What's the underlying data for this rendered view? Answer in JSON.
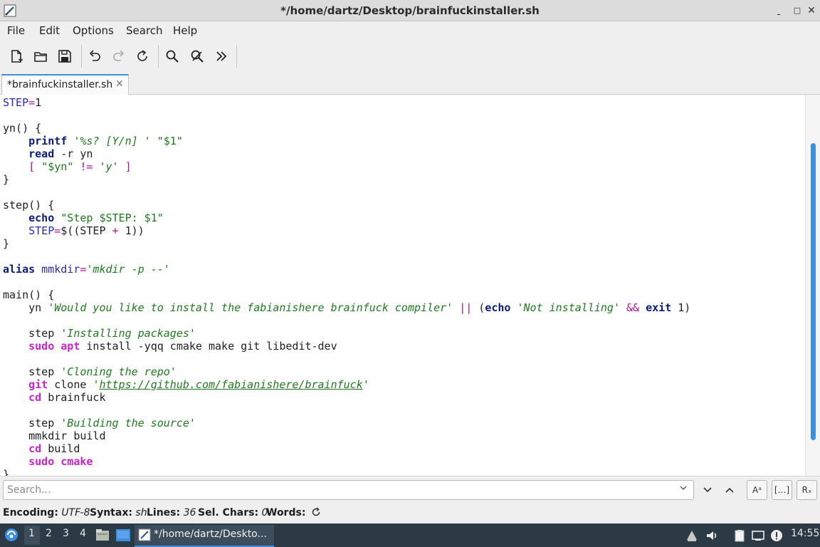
{
  "window": {
    "title": "*/home/dartz/Desktop/brainfuckinstaller.sh",
    "minimize": "ˍ",
    "restore": "□",
    "close": "✕"
  },
  "menu": [
    "File",
    "Edit",
    "Options",
    "Search",
    "Help"
  ],
  "toolbar": {
    "icons": [
      "new-file-icon",
      "open-folder-icon",
      "save-icon",
      "undo-icon",
      "redo-icon",
      "reload-icon",
      "find-icon",
      "find-replace-icon",
      "more-icon"
    ]
  },
  "tab": {
    "label": "*brainfuckinstaller.sh",
    "close": "✕"
  },
  "code_lines": [
    [
      [
        "v",
        "STEP"
      ],
      [
        "o",
        "="
      ],
      [
        "",
        "1"
      ]
    ],
    [],
    [
      [
        "",
        "yn() {"
      ]
    ],
    [
      [
        "",
        "    "
      ],
      [
        "k",
        "printf"
      ],
      [
        "",
        ""
      ],
      [
        "si",
        " '%s? [Y/n] '"
      ],
      [
        "s",
        " \"$1\""
      ]
    ],
    [
      [
        "",
        "    "
      ],
      [
        "k",
        "read"
      ],
      [
        "",
        " -r yn"
      ]
    ],
    [
      [
        "",
        "    "
      ],
      [
        "o",
        "["
      ],
      [
        "s",
        " \"$yn\""
      ],
      [
        "o",
        " !="
      ],
      [
        "si",
        " 'y'"
      ],
      [
        "o",
        " ]"
      ]
    ],
    [
      [
        "",
        "}"
      ]
    ],
    [],
    [
      [
        "",
        "step() {"
      ]
    ],
    [
      [
        "",
        "    "
      ],
      [
        "k",
        "echo"
      ],
      [
        "s",
        " \"Step $STEP: $1\""
      ]
    ],
    [
      [
        "",
        "    "
      ],
      [
        "v",
        "STEP"
      ],
      [
        "o",
        "="
      ],
      [
        "",
        "$((STEP "
      ],
      [
        "o",
        "+"
      ],
      [
        "",
        " 1))"
      ]
    ],
    [
      [
        "",
        "}"
      ]
    ],
    [],
    [
      [
        "k",
        "alias"
      ],
      [
        "v",
        " mmkdir"
      ],
      [
        "o",
        "="
      ],
      [
        "si",
        "'mkdir -p --'"
      ]
    ],
    [],
    [
      [
        "",
        "main() {"
      ]
    ],
    [
      [
        "",
        "    yn "
      ],
      [
        "si",
        "'Would you like to install the fabianishere brainfuck compiler'"
      ],
      [
        "o",
        " ||"
      ],
      [
        "",
        " ("
      ],
      [
        "k",
        "echo"
      ],
      [
        "si",
        " 'Not installing'"
      ],
      [
        "o",
        " &&"
      ],
      [
        "k",
        " exit"
      ],
      [
        "",
        " 1)"
      ]
    ],
    [],
    [
      [
        "",
        "    step "
      ],
      [
        "si",
        "'Installing packages'"
      ]
    ],
    [
      [
        "",
        "    "
      ],
      [
        "m",
        "sudo"
      ],
      [
        "",
        " "
      ],
      [
        "m",
        "apt"
      ],
      [
        "",
        " install -yqq cmake make git libedit-dev"
      ]
    ],
    [],
    [
      [
        "",
        "    step "
      ],
      [
        "si",
        "'Cloning the repo'"
      ]
    ],
    [
      [
        "",
        "    "
      ],
      [
        "m",
        "git"
      ],
      [
        "",
        " clone "
      ],
      [
        "si",
        "'"
      ],
      [
        "u",
        "https://github.com/fabianishere/brainfuck"
      ],
      [
        "si",
        "'"
      ]
    ],
    [
      [
        "",
        "    "
      ],
      [
        "m",
        "cd"
      ],
      [
        "",
        " brainfuck"
      ]
    ],
    [],
    [
      [
        "",
        "    step "
      ],
      [
        "si",
        "'Building the source'"
      ]
    ],
    [
      [
        "",
        "    mmkdir build"
      ]
    ],
    [
      [
        "",
        "    "
      ],
      [
        "m",
        "cd"
      ],
      [
        "",
        " build"
      ]
    ],
    [
      [
        "",
        "    "
      ],
      [
        "m",
        "sudo"
      ],
      [
        "",
        " "
      ],
      [
        "m",
        "cmake"
      ]
    ],
    [
      [
        "",
        "}"
      ]
    ]
  ],
  "search": {
    "placeholder": "Search...",
    "down": "⌄",
    "up": "⌃",
    "opt_case": "Aᵃ",
    "opt_word": "[…]",
    "opt_regex": "Rₓ"
  },
  "status": {
    "encoding_label": "Encoding:",
    "encoding_value": "UTF-8",
    "syntax_label": "Syntax:",
    "syntax_value": "sh",
    "lines_label": "Lines:",
    "lines_value": "36",
    "selchars_label": "Sel. Chars:",
    "selchars_value": "0",
    "words_label": "Words:"
  },
  "taskbar": {
    "workspaces": [
      "1",
      "2",
      "3",
      "4"
    ],
    "active_window": "*/home/dartz/Deskto...",
    "clock": "14:55"
  },
  "colors": {
    "accent": "#3d8ee0",
    "taskbar_bg": "#2c3a46"
  }
}
